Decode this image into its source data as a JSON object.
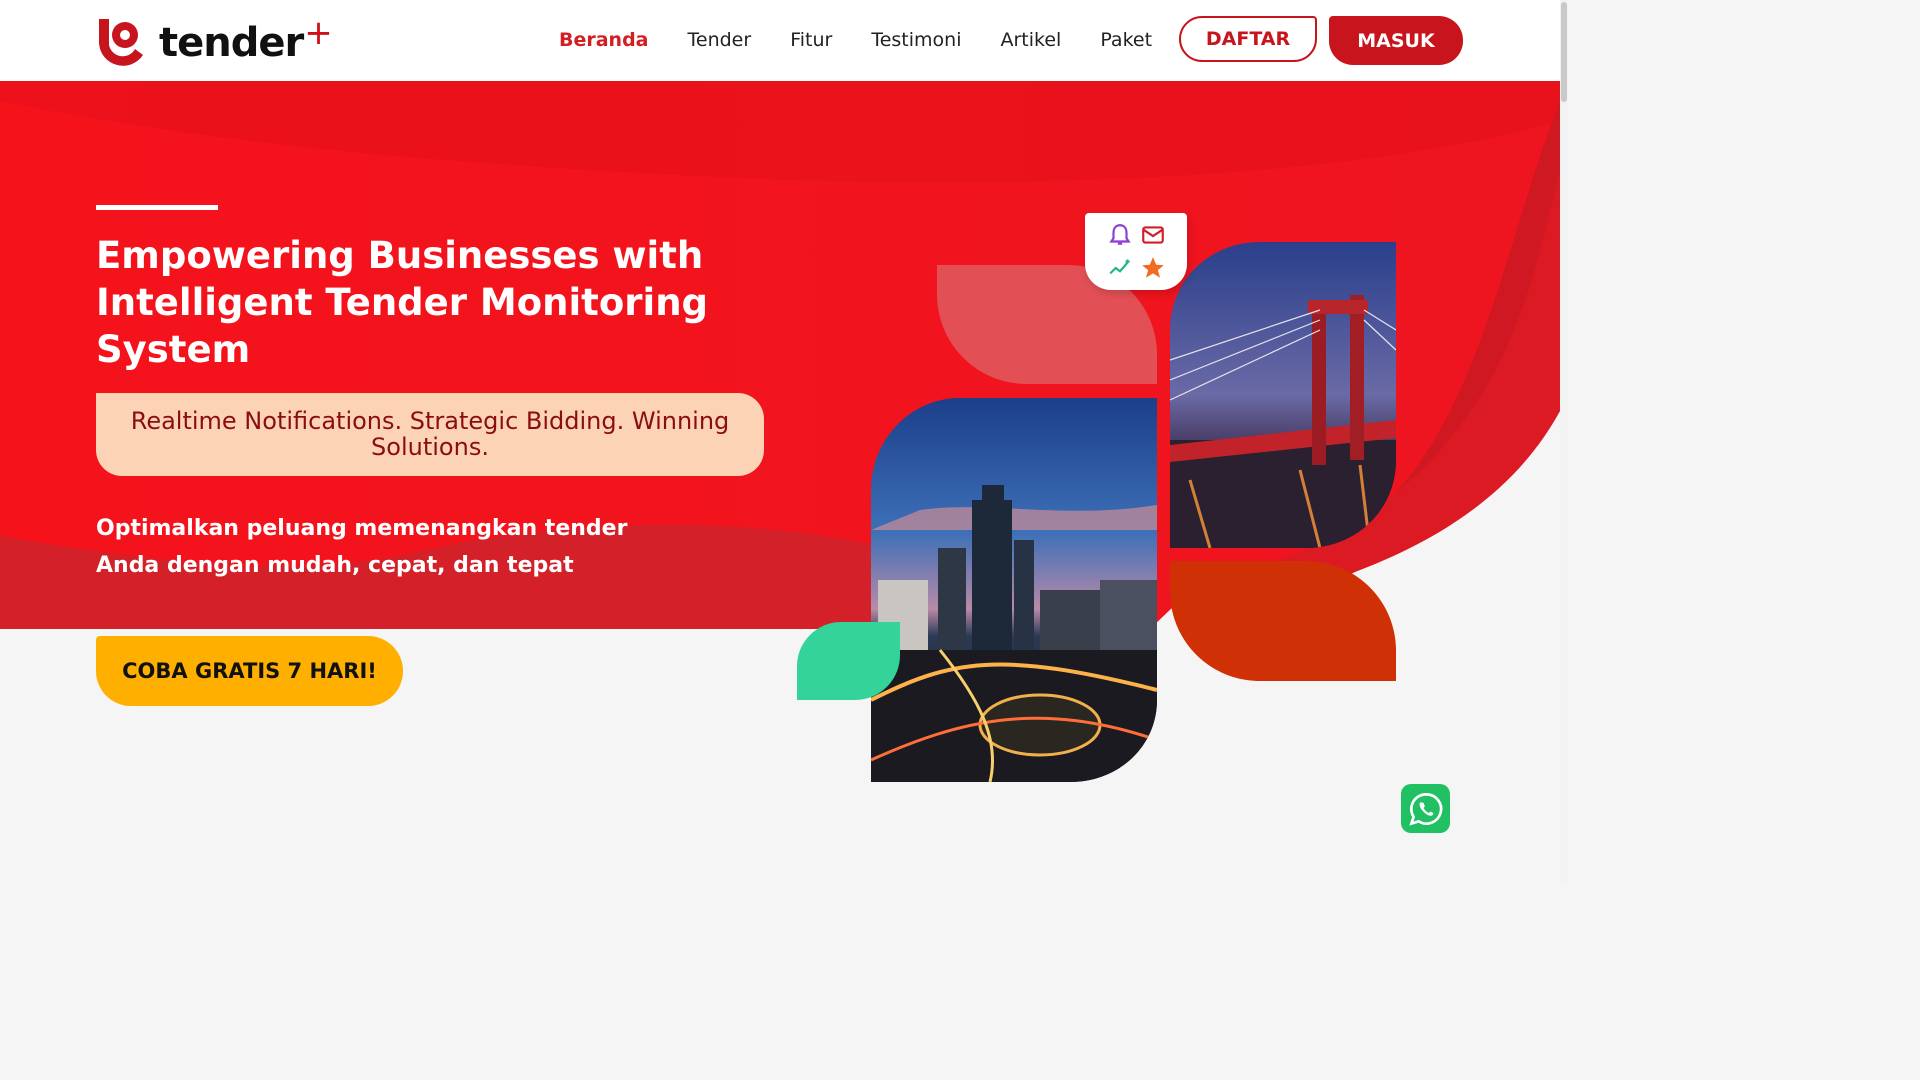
{
  "brand": {
    "logo_text": "tender",
    "logo_plus": "+",
    "primary_color": "#c8141c",
    "accent_yellow": "#ffaf00",
    "accent_green": "#33d399",
    "tagline_bg": "#fdd3b6"
  },
  "nav": {
    "items": [
      {
        "label": "Beranda",
        "active": true
      },
      {
        "label": "Tender",
        "active": false
      },
      {
        "label": "Fitur",
        "active": false
      },
      {
        "label": "Testimoni",
        "active": false
      },
      {
        "label": "Artikel",
        "active": false
      },
      {
        "label": "Paket",
        "active": false
      }
    ],
    "register_label": "DAFTAR",
    "login_label": "MASUK"
  },
  "hero": {
    "title": "Empowering Businesses with Intelligent Tender Monitoring System",
    "tagline": "Realtime Notifications. Strategic Bidding. Winning Solutions.",
    "description": "Optimalkan peluang memenangkan tender Anda dengan mudah, cepat, dan tepat",
    "cta_label": "COBA GRATIS 7 HARI!"
  },
  "collage": {
    "images": [
      {
        "name": "jakarta-city-night-photo"
      },
      {
        "name": "ampera-bridge-night-photo"
      }
    ],
    "notif_icons": [
      "bell-icon",
      "mail-icon",
      "sparkle-chart-icon",
      "star-icon"
    ]
  },
  "floating": {
    "whatsapp_icon": "whatsapp-icon"
  }
}
